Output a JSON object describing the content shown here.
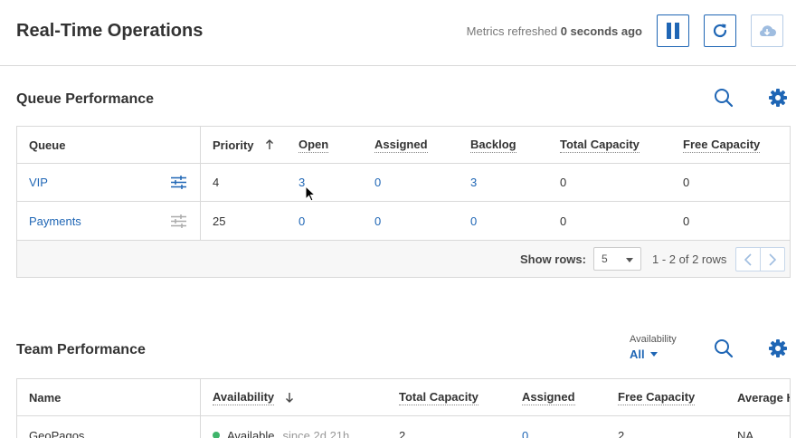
{
  "header": {
    "title": "Real-Time Operations",
    "refresh_prefix": "Metrics refreshed",
    "refresh_value": "0 seconds ago"
  },
  "queue_section": {
    "title": "Queue Performance",
    "columns": [
      "Queue",
      "Priority",
      "Open",
      "Assigned",
      "Backlog",
      "Total Capacity",
      "Free Capacity"
    ],
    "rows": [
      {
        "queue": "VIP",
        "priority": "4",
        "open": "3",
        "assigned": "0",
        "backlog": "3",
        "total_capacity": "0",
        "free_capacity": "0"
      },
      {
        "queue": "Payments",
        "priority": "25",
        "open": "0",
        "assigned": "0",
        "backlog": "0",
        "total_capacity": "0",
        "free_capacity": "0"
      }
    ],
    "footer": {
      "show_rows_label": "Show rows:",
      "rows_per_page": "5",
      "range": "1 - 2 of 2 rows"
    }
  },
  "team_section": {
    "title": "Team Performance",
    "filter_label": "Availability",
    "filter_value": "All",
    "columns": [
      "Name",
      "Availability",
      "Total Capacity",
      "Assigned",
      "Free Capacity",
      "Average H"
    ],
    "rows": [
      {
        "name": "GeoPagos",
        "availability": "Available",
        "since": "since 2d 21h",
        "total_capacity": "2",
        "assigned": "0",
        "free_capacity": "2",
        "average": "NA"
      }
    ]
  },
  "colors": {
    "accent": "#1f66b5",
    "available": "#3fb56b",
    "border": "#d9d9d9"
  }
}
